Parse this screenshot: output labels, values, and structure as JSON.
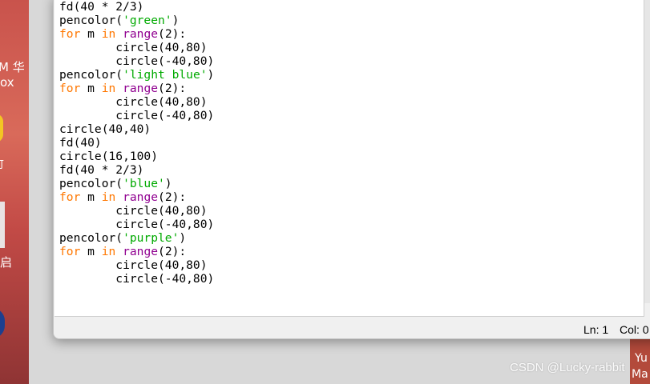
{
  "desktop": {
    "left_labels": [
      "M 华",
      "ox",
      "可",
      "启"
    ],
    "right_labels": [
      "Yu",
      "Ma"
    ]
  },
  "editor": {
    "lines": [
      [
        {
          "t": "circle(16,100)",
          "c": ""
        }
      ],
      [
        {
          "t": "fd(40 * 2/3)",
          "c": ""
        }
      ],
      [
        {
          "t": "pencolor(",
          "c": ""
        },
        {
          "t": "'green'",
          "c": "str"
        },
        {
          "t": ")",
          "c": ""
        }
      ],
      [
        {
          "t": "for",
          "c": "kw"
        },
        {
          "t": " m ",
          "c": ""
        },
        {
          "t": "in",
          "c": "kw"
        },
        {
          "t": " ",
          "c": ""
        },
        {
          "t": "range",
          "c": "bi"
        },
        {
          "t": "(2):",
          "c": ""
        }
      ],
      [
        {
          "t": "        circle(40,80)",
          "c": ""
        }
      ],
      [
        {
          "t": "        circle(-40,80)",
          "c": ""
        }
      ],
      [
        {
          "t": "pencolor(",
          "c": ""
        },
        {
          "t": "'light blue'",
          "c": "str"
        },
        {
          "t": ")",
          "c": ""
        }
      ],
      [
        {
          "t": "for",
          "c": "kw"
        },
        {
          "t": " m ",
          "c": ""
        },
        {
          "t": "in",
          "c": "kw"
        },
        {
          "t": " ",
          "c": ""
        },
        {
          "t": "range",
          "c": "bi"
        },
        {
          "t": "(2):",
          "c": ""
        }
      ],
      [
        {
          "t": "        circle(40,80)",
          "c": ""
        }
      ],
      [
        {
          "t": "        circle(-40,80)",
          "c": ""
        }
      ],
      [
        {
          "t": "circle(40,40)",
          "c": ""
        }
      ],
      [
        {
          "t": "fd(40)",
          "c": ""
        }
      ],
      [
        {
          "t": "circle(16,100)",
          "c": ""
        }
      ],
      [
        {
          "t": "fd(40 * 2/3)",
          "c": ""
        }
      ],
      [
        {
          "t": "pencolor(",
          "c": ""
        },
        {
          "t": "'blue'",
          "c": "str"
        },
        {
          "t": ")",
          "c": ""
        }
      ],
      [
        {
          "t": "for",
          "c": "kw"
        },
        {
          "t": " m ",
          "c": ""
        },
        {
          "t": "in",
          "c": "kw"
        },
        {
          "t": " ",
          "c": ""
        },
        {
          "t": "range",
          "c": "bi"
        },
        {
          "t": "(2):",
          "c": ""
        }
      ],
      [
        {
          "t": "        circle(40,80)",
          "c": ""
        }
      ],
      [
        {
          "t": "        circle(-40,80)",
          "c": ""
        }
      ],
      [
        {
          "t": "pencolor(",
          "c": ""
        },
        {
          "t": "'purple'",
          "c": "str"
        },
        {
          "t": ")",
          "c": ""
        }
      ],
      [
        {
          "t": "for",
          "c": "kw"
        },
        {
          "t": " m ",
          "c": ""
        },
        {
          "t": "in",
          "c": "kw"
        },
        {
          "t": " ",
          "c": ""
        },
        {
          "t": "range",
          "c": "bi"
        },
        {
          "t": "(2):",
          "c": ""
        }
      ],
      [
        {
          "t": "        circle(40,80)",
          "c": ""
        }
      ],
      [
        {
          "t": "        circle(-40,80)",
          "c": ""
        }
      ]
    ]
  },
  "status": {
    "ln": "Ln: 1",
    "col": "Col: 0"
  },
  "watermark": "CSDN @Lucky-rabbit",
  "colors": {
    "keyword": "#ff7700",
    "builtin": "#900090",
    "string": "#00aa00"
  }
}
